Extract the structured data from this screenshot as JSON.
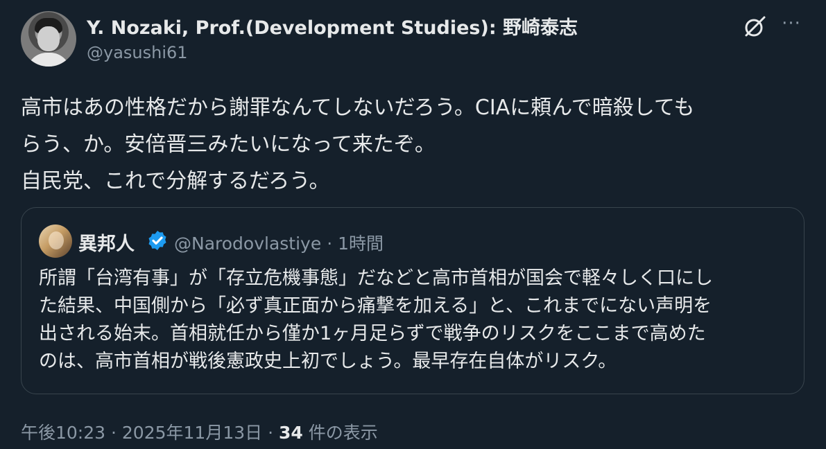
{
  "author": {
    "display_name": "Y. Nozaki, Prof.(Development Studies): 野崎泰志",
    "handle": "@yasushi61",
    "avatar_icon": "user-avatar-photo"
  },
  "header_icons": {
    "grok": "grok-icon",
    "more": "more-options-icon",
    "more_glyph": "···"
  },
  "tweet": {
    "lines": [
      "高市はあの性格だから謝罪なんてしないだろう。CIAに頼んで暗殺しても",
      "らう、か。安倍晋三みたいになって来たぞ。",
      "自民党、これで分解するだろう。"
    ]
  },
  "quote": {
    "display_name": "異邦人",
    "handle": "@Narodovlastiye",
    "separator": "·",
    "time": "1時間",
    "verified_color": "#1d9bf0",
    "lines": [
      "所謂「台湾有事」が「存立危機事態」だなどと高市首相が国会で軽々しく口にし",
      "た結果、中国側から「必ず真正面から痛撃を加える」と、これまでにない声明を",
      "出される始末。首相就任から僅か1ヶ月足らずで戦争のリスクをここまで高めた",
      "のは、高市首相が戦後憲政史上初でしょう。最早存在自体がリスク。"
    ]
  },
  "footer": {
    "time": "午後10:23",
    "sep1": "·",
    "date": "2025年11月13日",
    "sep2": "·",
    "view_count": "34",
    "view_label": "件の表示"
  },
  "colors": {
    "background": "#15202b",
    "text": "#e7e9ea",
    "muted": "#8b98a5",
    "border": "#38444d"
  }
}
